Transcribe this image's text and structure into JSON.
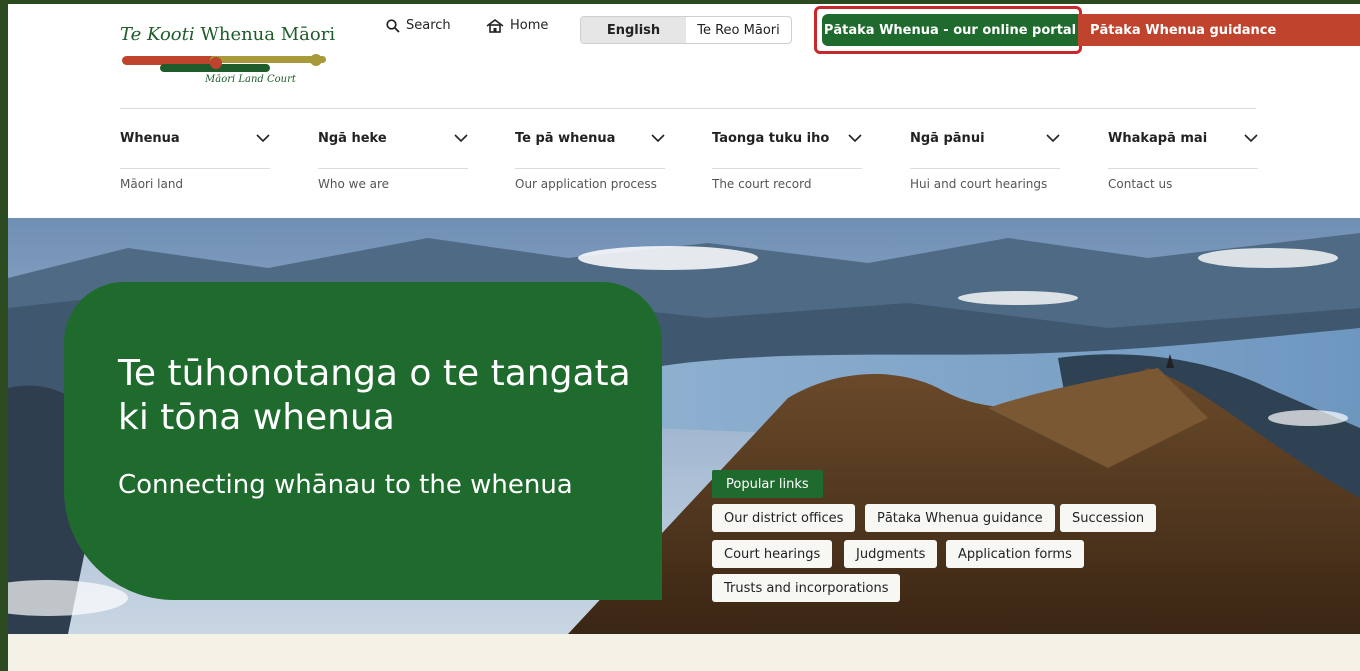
{
  "logo": {
    "title_italic": "Te Kooti",
    "title_rest": " Whenua Māori",
    "subtitle": "Māori Land Court",
    "colors": {
      "green": "#1e5d2b",
      "orange": "#c0432d",
      "olive": "#a89a3a"
    }
  },
  "header": {
    "search_label": "Search",
    "home_label": "Home",
    "lang_english": "English",
    "lang_maori": "Te Reo Māori",
    "portal_label": "Pātaka Whenua - our online portal",
    "guidance_label": "Pātaka Whenua guidance"
  },
  "nav": [
    {
      "label": "Whenua",
      "sub": "Māori land"
    },
    {
      "label": "Ngā heke",
      "sub": "Who we are"
    },
    {
      "label": "Te pā whenua",
      "sub": "Our application process"
    },
    {
      "label": "Taonga tuku iho",
      "sub": "The court record"
    },
    {
      "label": "Ngā pānui",
      "sub": "Hui and court hearings"
    },
    {
      "label": "Whakapā mai",
      "sub": "Contact us"
    }
  ],
  "hero": {
    "title": "Te tūhonotanga o te tangata ki tōna whenua",
    "subtitle": "Connecting whānau to the whenua",
    "popular_label": "Popular links",
    "links": [
      "Our district offices",
      "Pātaka Whenua guidance",
      "Succession",
      "Court hearings",
      "Judgments",
      "Application forms",
      "Trusts and incorporations"
    ]
  },
  "colors": {
    "primary_green": "#1f6b2e",
    "accent_red": "#c0432d",
    "highlight": "#c8282b"
  }
}
